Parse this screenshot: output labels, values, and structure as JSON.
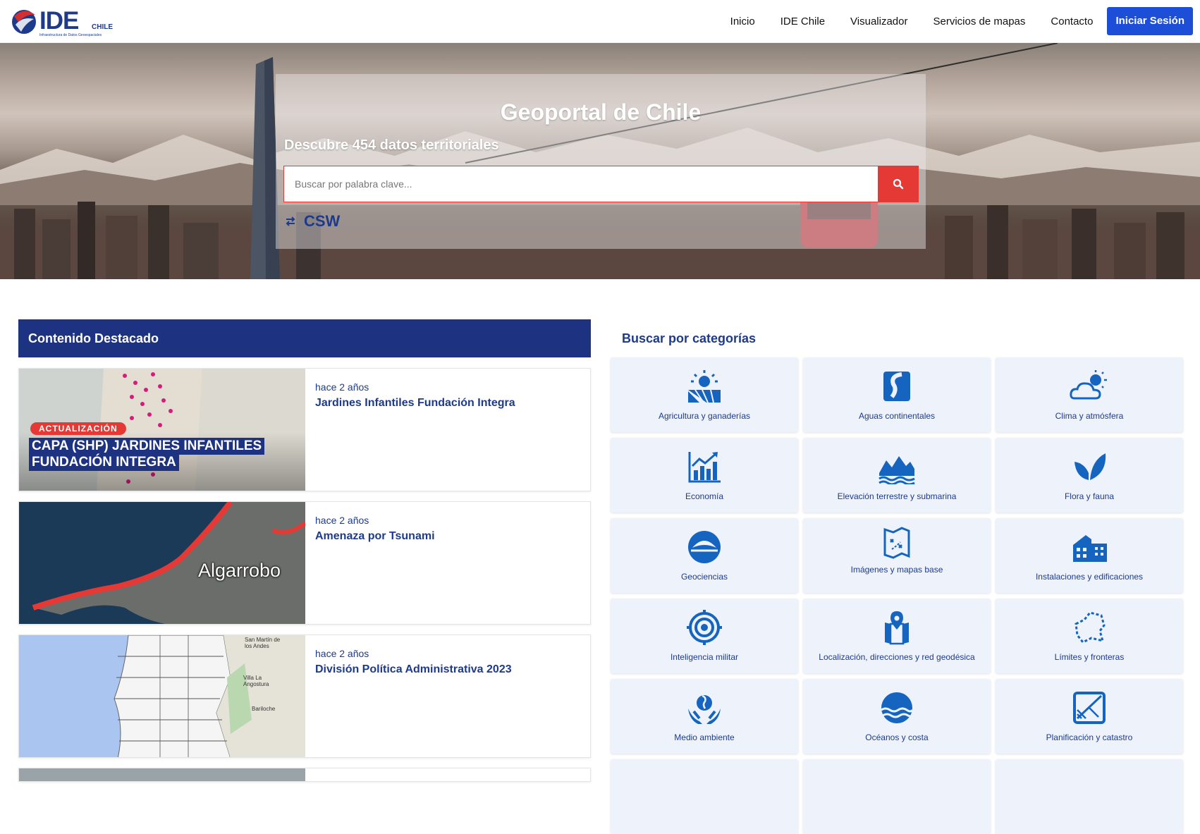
{
  "header": {
    "logo": {
      "name": "IDE",
      "country": "CHILE",
      "tagline": "Infraestructura de Datos Geoespaciales"
    },
    "nav": [
      "Inicio",
      "IDE Chile",
      "Visualizador",
      "Servicios de mapas",
      "Contacto"
    ],
    "login_label": "Iniciar Sesión"
  },
  "hero": {
    "title": "Geoportal de Chile",
    "subtitle": "Descubre 454 datos territoriales",
    "search_placeholder": "Buscar por palabra clave...",
    "csw_label": "CSW"
  },
  "featured": {
    "heading": "Contenido Destacado",
    "items": [
      {
        "date": "hace 2 años",
        "title": "Jardines Infantiles Fundación Integra",
        "image_badge": "ACTUALIZACIÓN",
        "image_line1": "CAPA (SHP) JARDINES INFANTILES",
        "image_line2": "FUNDACIÓN INTEGRA"
      },
      {
        "date": "hace 2 años",
        "title": "Amenaza por Tsunami",
        "image_label": "Algarrobo"
      },
      {
        "date": "hace 2 años",
        "title": "División Política Administrativa 2023",
        "image_labels": [
          "San Martín de los Andes",
          "Villa La Angostura",
          "Bariloche"
        ]
      }
    ]
  },
  "categories": {
    "heading": "Buscar por categorías",
    "items": [
      {
        "label": "Agricultura y ganaderías",
        "icon": "agriculture-icon"
      },
      {
        "label": "Aguas continentales",
        "icon": "inland-water-icon"
      },
      {
        "label": "Clima y atmósfera",
        "icon": "climate-icon"
      },
      {
        "label": "Economía",
        "icon": "economy-icon"
      },
      {
        "label": "Elevación terrestre y submarina",
        "icon": "elevation-icon"
      },
      {
        "label": "Flora y fauna",
        "icon": "flora-fauna-icon"
      },
      {
        "label": "Geociencias",
        "icon": "geosciences-icon"
      },
      {
        "label": "Imágenes y mapas base",
        "icon": "basemap-icon"
      },
      {
        "label": "Instalaciones y edificaciones",
        "icon": "buildings-icon"
      },
      {
        "label": "Inteligencia militar",
        "icon": "military-icon"
      },
      {
        "label": "Localización, direcciones y red geodésica",
        "icon": "location-icon"
      },
      {
        "label": "Límites y fronteras",
        "icon": "boundaries-icon"
      },
      {
        "label": "Medio ambiente",
        "icon": "environment-icon"
      },
      {
        "label": "Océanos y costa",
        "icon": "ocean-icon"
      },
      {
        "label": "Planificación y catastro",
        "icon": "planning-icon"
      }
    ]
  },
  "colors": {
    "primary": "#1e3a8a",
    "button": "#1d4ed8",
    "accent_red": "#e53935",
    "featured_header": "#1e3282",
    "category_bg": "#eef3fb"
  }
}
